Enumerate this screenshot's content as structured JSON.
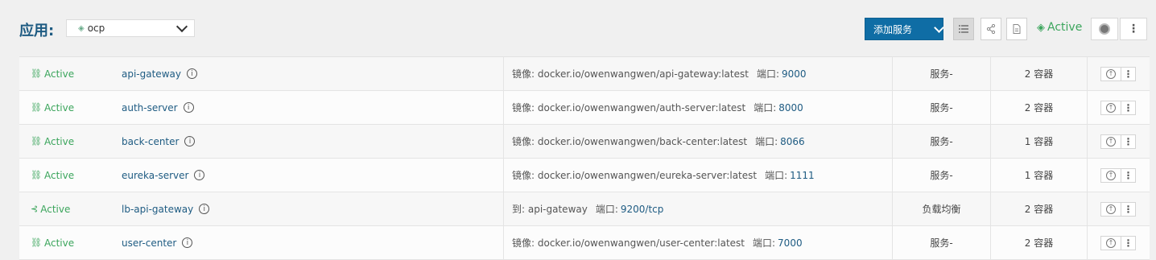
{
  "header": {
    "app_label": "应用:",
    "app_select_value": "ocp",
    "add_service_label": "添加服务",
    "state_label": "Active",
    "more_glyph": "⋮"
  },
  "icons": {
    "state_active": "network-icon",
    "state_lb": "balancer-icon",
    "view_list": "list-icon",
    "view_graph": "share-icon",
    "view_file": "file-icon",
    "stack": "layers-icon"
  },
  "colors": {
    "accent": "#0f6da5",
    "link": "#1e5b82",
    "active": "#3ba55c"
  },
  "services": [
    {
      "state": "Active",
      "state_icon": "network",
      "name": "api-gateway",
      "detail_prefix": "镜像:",
      "detail": "docker.io/owenwangwen/api-gateway:latest",
      "port_label": "端口:",
      "port": "9000",
      "type": "服务-",
      "count": "2 容器"
    },
    {
      "state": "Active",
      "state_icon": "network",
      "name": "auth-server",
      "detail_prefix": "镜像:",
      "detail": "docker.io/owenwangwen/auth-server:latest",
      "port_label": "端口:",
      "port": "8000",
      "type": "服务-",
      "count": "2 容器"
    },
    {
      "state": "Active",
      "state_icon": "network",
      "name": "back-center",
      "detail_prefix": "镜像:",
      "detail": "docker.io/owenwangwen/back-center:latest",
      "port_label": "端口:",
      "port": "8066",
      "type": "服务-",
      "count": "1 容器"
    },
    {
      "state": "Active",
      "state_icon": "network",
      "name": "eureka-server",
      "detail_prefix": "镜像:",
      "detail": "docker.io/owenwangwen/eureka-server:latest",
      "port_label": "端口:",
      "port": "1111",
      "type": "服务-",
      "count": "1 容器"
    },
    {
      "state": "Active",
      "state_icon": "balancer",
      "name": "lb-api-gateway",
      "detail_prefix": "到:",
      "detail": "api-gateway",
      "port_label": "端口:",
      "port": "9200/tcp",
      "type": "负载均衡",
      "count": "2 容器"
    },
    {
      "state": "Active",
      "state_icon": "network",
      "name": "user-center",
      "detail_prefix": "镜像:",
      "detail": "docker.io/owenwangwen/user-center:latest",
      "port_label": "端口:",
      "port": "7000",
      "type": "服务-",
      "count": "2 容器"
    }
  ]
}
